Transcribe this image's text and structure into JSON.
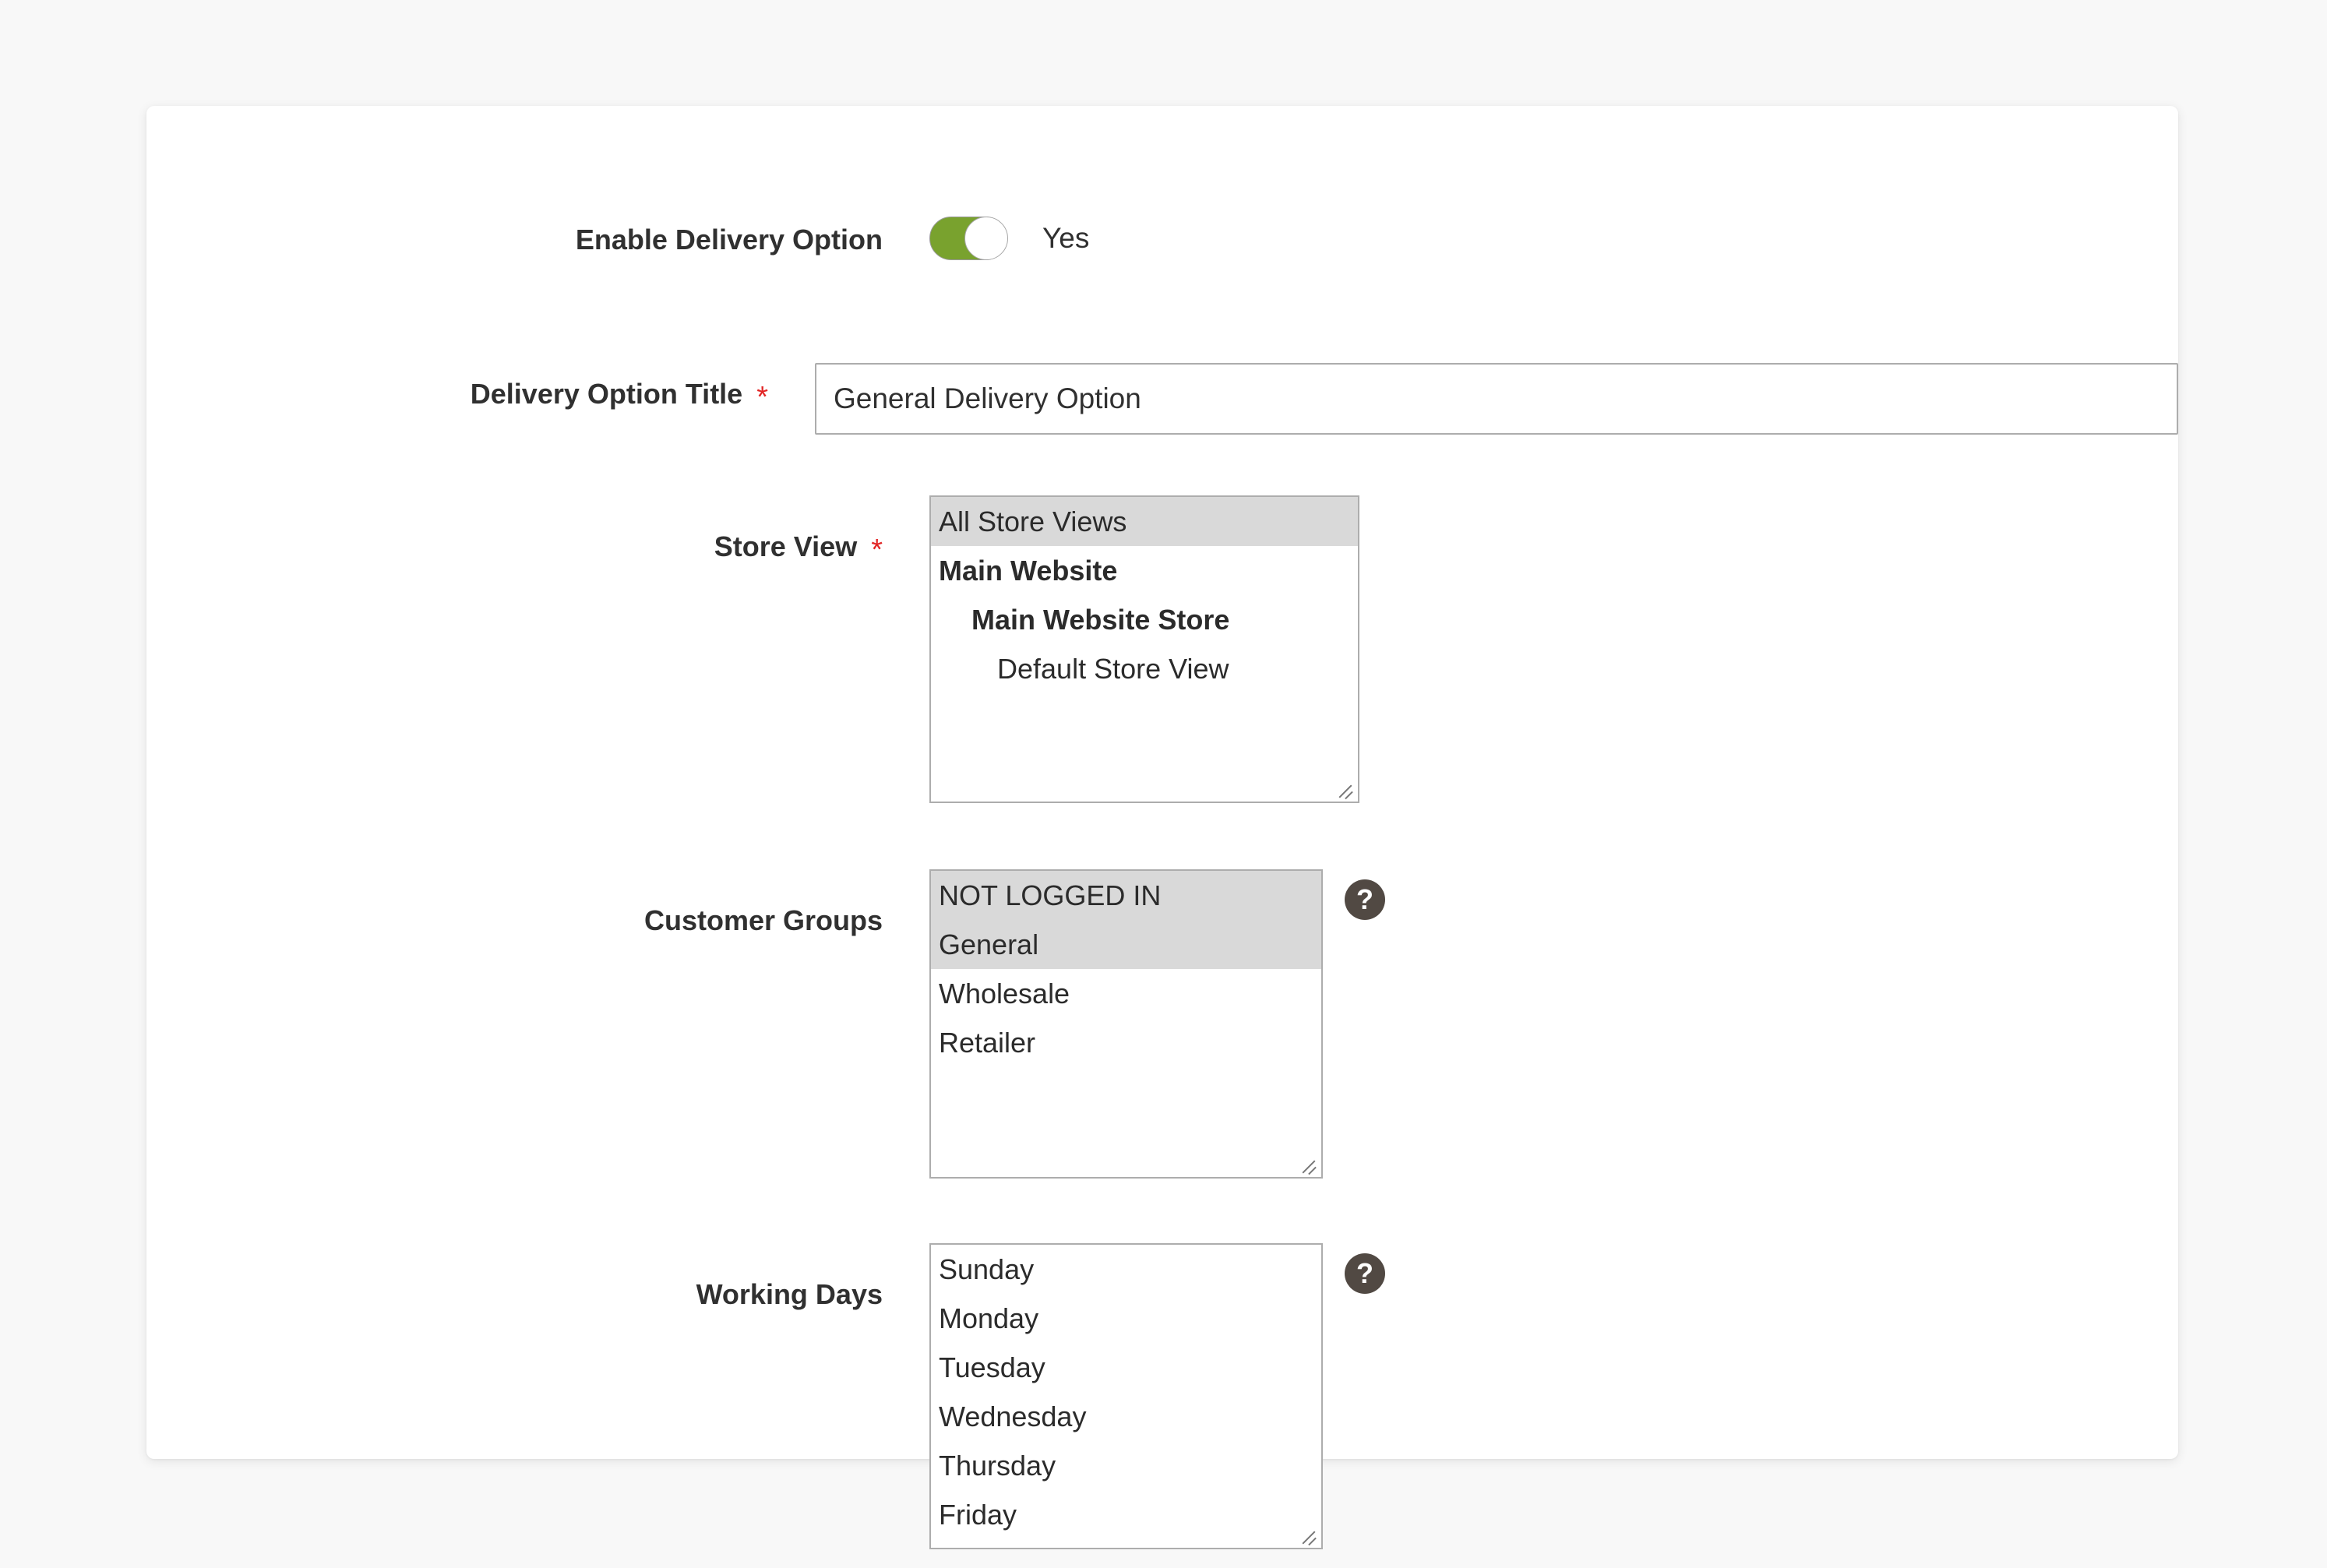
{
  "colors": {
    "page_background": "#f8f8f8",
    "panel_background": "#ffffff",
    "label_text": "#303030",
    "required_star": "#e22626",
    "toggle_on": "#79a22e",
    "input_border": "#adadad",
    "option_selected_background": "#d9d9d9",
    "help_icon_background": "#514943"
  },
  "form": {
    "enable_delivery_option": {
      "label": "Enable Delivery Option",
      "required": false,
      "toggle_state_label": "Yes",
      "toggle_on": true
    },
    "delivery_option_title": {
      "label": "Delivery Option Title",
      "required": true,
      "required_marker": "*",
      "value": "General Delivery Option",
      "placeholder": ""
    },
    "store_view": {
      "label": "Store View",
      "required": true,
      "required_marker": "*",
      "options": [
        {
          "text": "All Store Views",
          "selected": true,
          "bold": false,
          "indent": 0
        },
        {
          "text": "Main Website",
          "selected": false,
          "bold": true,
          "indent": 0
        },
        {
          "text": "Main Website Store",
          "selected": false,
          "bold": true,
          "indent": 1
        },
        {
          "text": "Default Store View",
          "selected": false,
          "bold": false,
          "indent": 2
        }
      ]
    },
    "customer_groups": {
      "label": "Customer Groups",
      "required": false,
      "help_icon": "question-mark-icon",
      "options": [
        {
          "text": "NOT LOGGED IN",
          "selected": true,
          "bold": false,
          "indent": 0
        },
        {
          "text": "General",
          "selected": true,
          "bold": false,
          "indent": 0
        },
        {
          "text": "Wholesale",
          "selected": false,
          "bold": false,
          "indent": 0
        },
        {
          "text": "Retailer",
          "selected": false,
          "bold": false,
          "indent": 0
        }
      ]
    },
    "working_days": {
      "label": "Working Days",
      "required": false,
      "help_icon": "question-mark-icon",
      "options": [
        {
          "text": "Sunday",
          "selected": false,
          "bold": false,
          "indent": 0
        },
        {
          "text": "Monday",
          "selected": false,
          "bold": false,
          "indent": 0
        },
        {
          "text": "Tuesday",
          "selected": false,
          "bold": false,
          "indent": 0
        },
        {
          "text": "Wednesday",
          "selected": false,
          "bold": false,
          "indent": 0
        },
        {
          "text": "Thursday",
          "selected": false,
          "bold": false,
          "indent": 0
        },
        {
          "text": "Friday",
          "selected": false,
          "bold": false,
          "indent": 0
        }
      ]
    }
  },
  "help_icon_glyph": "?"
}
